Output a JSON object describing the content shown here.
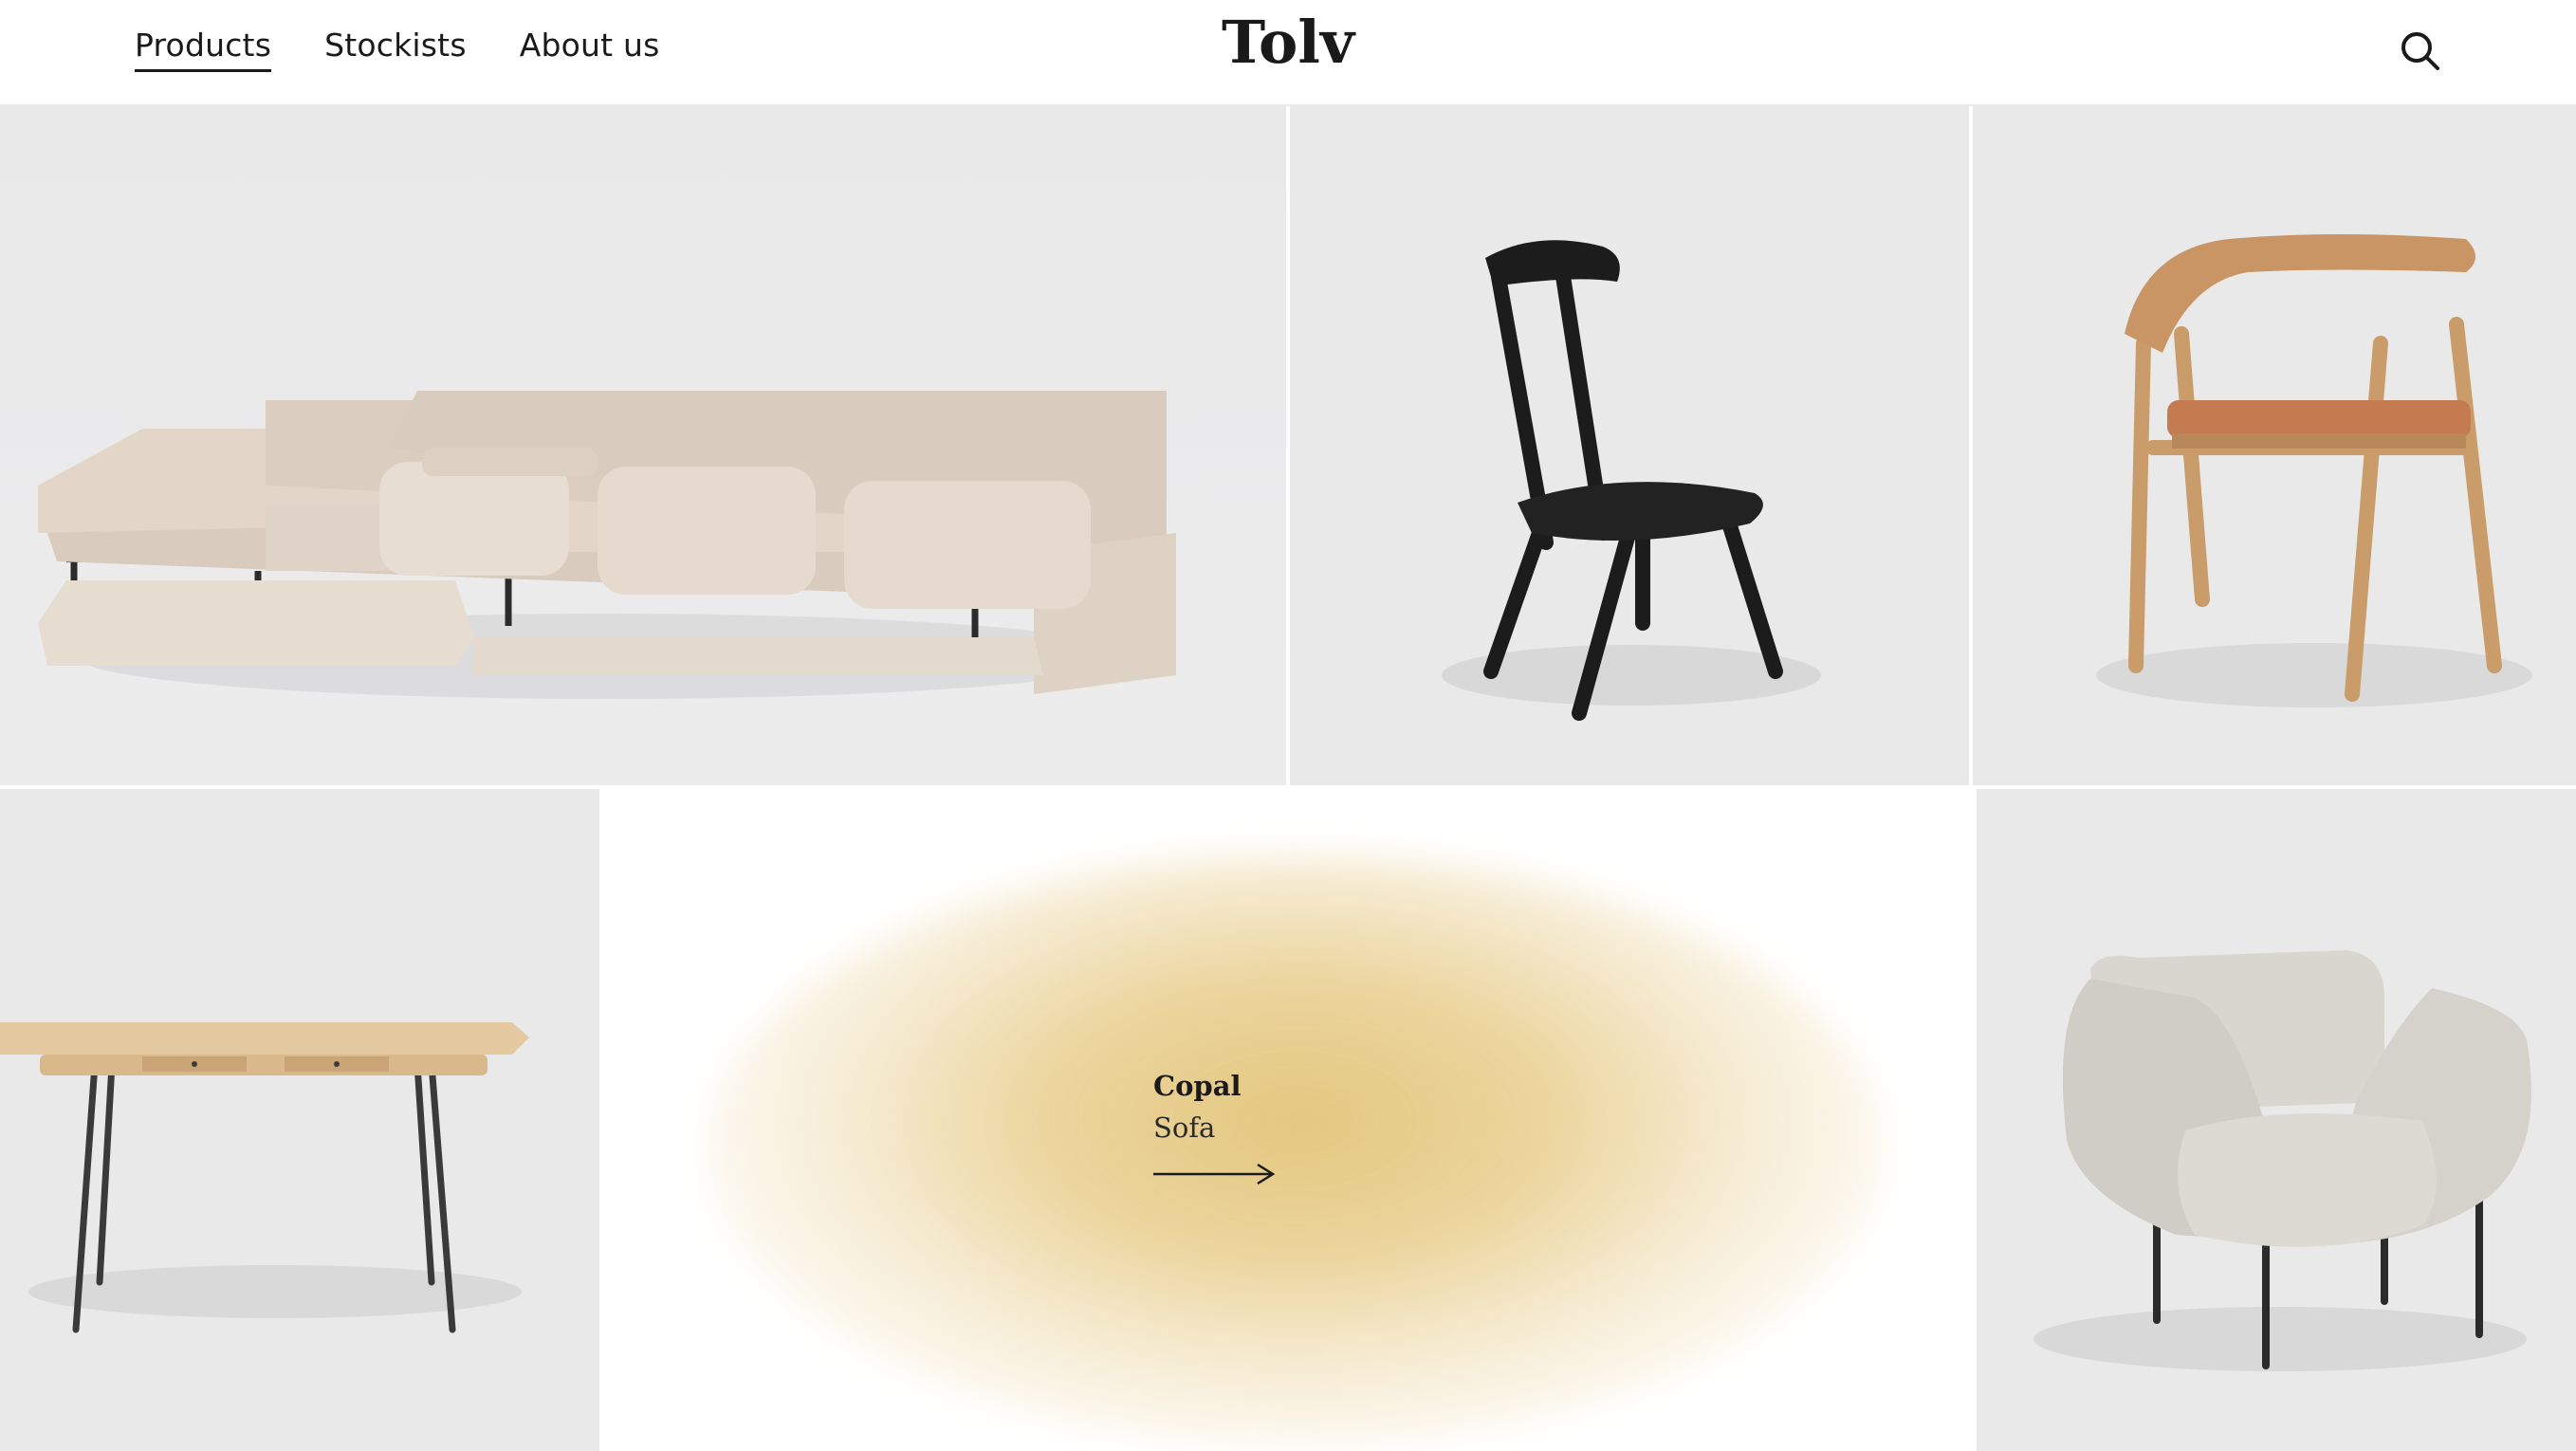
{
  "nav": {
    "items": [
      {
        "label": "Products",
        "active": true
      },
      {
        "label": "Stockists",
        "active": false
      },
      {
        "label": "About us",
        "active": false
      }
    ]
  },
  "brand": {
    "logo": "Tolv"
  },
  "header": {
    "search_icon": "search-icon"
  },
  "products": [
    {
      "name": "sofa-image"
    },
    {
      "name": "black-chair-image"
    },
    {
      "name": "oak-armchair-image"
    },
    {
      "name": "desk-image"
    },
    {
      "name": "lounge-chair-image"
    }
  ],
  "feature": {
    "name": "Copal",
    "type": "Sofa",
    "link_icon": "arrow-right-icon"
  },
  "colors": {
    "tile_background": "#ebebec",
    "feature_glow": "#e2c478",
    "text": "#1a1a1a"
  }
}
